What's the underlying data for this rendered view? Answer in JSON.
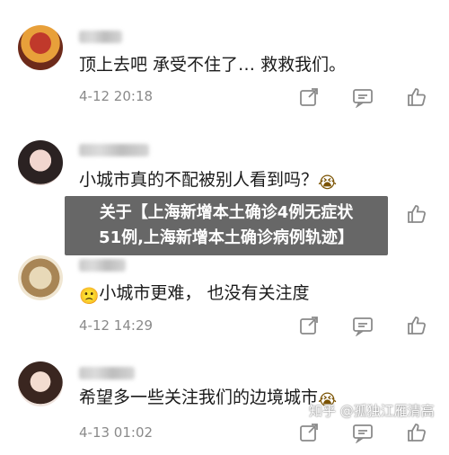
{
  "comments": [
    {
      "content": "顶上去吧   承受不住了… 救救我们。",
      "time": "4-12 20:18",
      "emoji": ""
    },
    {
      "content": "小城市真的不配被别人看到吗？",
      "time": "",
      "emoji": "😭"
    },
    {
      "content": "小城市更难，  也没有关注度",
      "time": "4-12 14:29",
      "emoji": "🙁"
    },
    {
      "content": "希望多一些关注我们的边境城市",
      "time": "4-13 01:02",
      "emoji": "😭"
    }
  ],
  "banner": {
    "line1": "关于【上海新增本土确诊4例无症状",
    "line2": "51例,上海新增本土确诊病例轨迹】"
  },
  "watermark": "知乎 @孤独江雁清高",
  "icons": {
    "share": "share-icon",
    "comment": "comment-icon",
    "like": "thumbs-up-icon"
  }
}
